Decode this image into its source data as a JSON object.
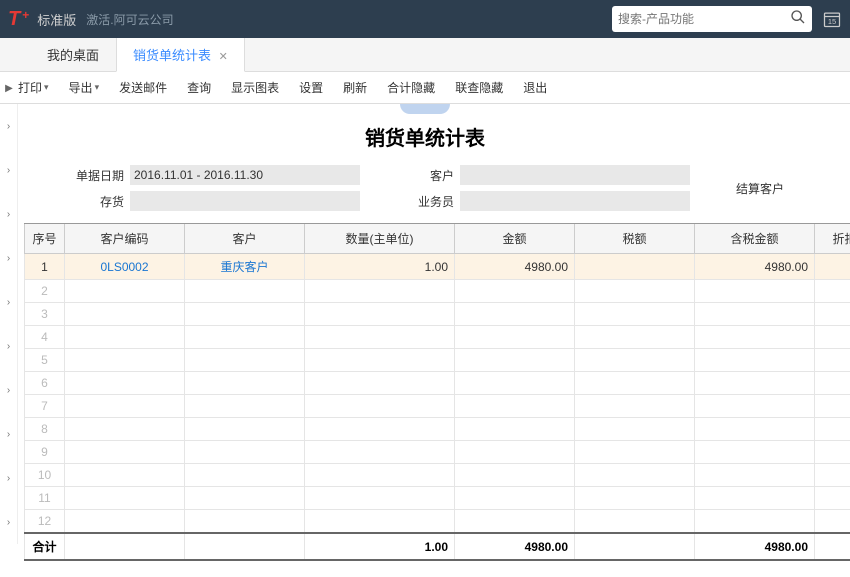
{
  "header": {
    "logo_t": "T",
    "logo_plus": "+",
    "edition": "标准版",
    "company": "激活.阿可云公司",
    "search_placeholder": "搜索-产品功能",
    "cal_day": "15"
  },
  "tabs": [
    {
      "label": "我的桌面",
      "active": false
    },
    {
      "label": "销货单统计表",
      "active": true
    }
  ],
  "toolbar": {
    "print": "打印",
    "export": "导出",
    "send_mail": "发送邮件",
    "query": "查询",
    "show_chart": "显示图表",
    "settings": "设置",
    "refresh": "刷新",
    "hide_total": "合计隐藏",
    "hide_link": "联查隐藏",
    "exit": "退出"
  },
  "report": {
    "title": "销货单统计表"
  },
  "filters": {
    "doc_date_label": "单据日期",
    "doc_date_value": "2016.11.01 - 2016.11.30",
    "inventory_label": "存货",
    "inventory_value": "",
    "customer_label": "客户",
    "customer_value": "",
    "salesman_label": "业务员",
    "salesman_value": "",
    "settle_customer_label": "结算客户"
  },
  "table": {
    "columns": {
      "seq": "序号",
      "customer_code": "客户编码",
      "customer": "客户",
      "qty": "数量(主单位)",
      "amount": "金额",
      "tax": "税额",
      "tax_amount": "含税金额",
      "discount": "折扣"
    },
    "rows": [
      {
        "seq": "1",
        "code": "0LS0002",
        "customer": "重庆客户",
        "qty": "1.00",
        "amount": "4980.00",
        "tax": "",
        "tax_amount": "4980.00"
      }
    ],
    "empty_rows": [
      "2",
      "3",
      "4",
      "5",
      "6",
      "7",
      "8",
      "9",
      "10",
      "11",
      "12"
    ],
    "total": {
      "label": "合计",
      "qty": "1.00",
      "amount": "4980.00",
      "tax": "",
      "tax_amount": "4980.00"
    }
  }
}
